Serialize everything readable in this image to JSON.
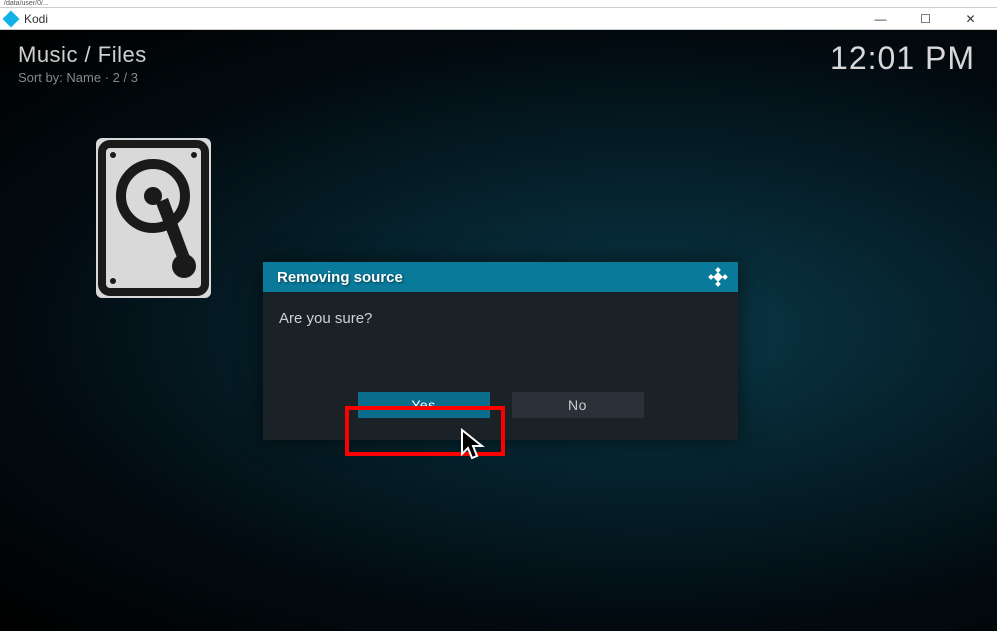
{
  "addressbar_text": "/data/user/0/...",
  "window": {
    "title": "Kodi"
  },
  "breadcrumb": {
    "main": "Music / Files",
    "sort_label": "Sort by: Name  ·  2 / 3"
  },
  "clock": "12:01 PM",
  "dialog": {
    "title": "Removing source",
    "message": "Are you sure?",
    "yes_label": "Yes",
    "no_label": "No"
  },
  "win_buttons": {
    "minimize": "—",
    "maximize": "☐",
    "close": "✕"
  }
}
